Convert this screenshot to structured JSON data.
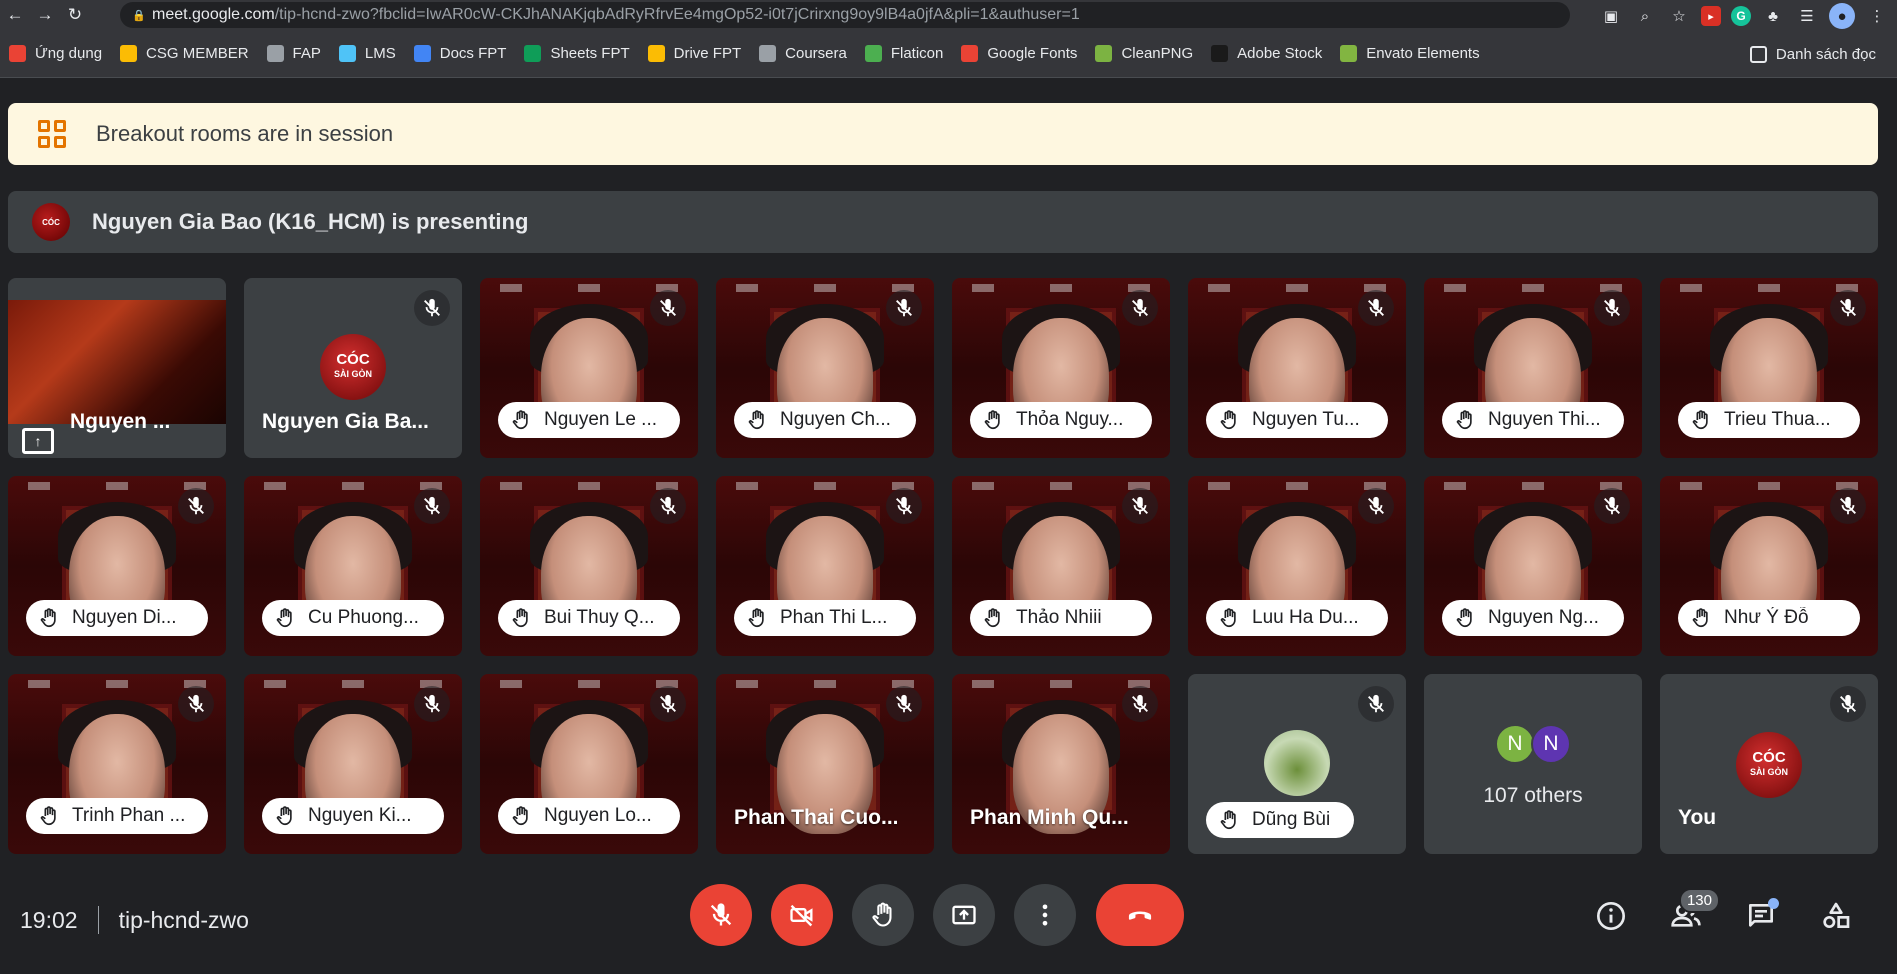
{
  "browser": {
    "url_host": "meet.google.com",
    "url_rest": "/tip-hcnd-zwo?fbclid=IwAR0cW-CKJhANAKjqbAdRyRfrvEe4mgOp52-i0t7jCrirxng9oy9lB4a0jfA&pli=1&authuser=1",
    "bookmarks": [
      {
        "label": "Ứng dụng",
        "icon": "apps-grid-icon",
        "color": "#ea4335"
      },
      {
        "label": "CSG MEMBER",
        "icon": "crown-icon",
        "color": "#fbbc04"
      },
      {
        "label": "FAP",
        "icon": "globe-icon",
        "color": "#9aa0a6"
      },
      {
        "label": "LMS",
        "icon": "lms-icon",
        "color": "#4fc3f7"
      },
      {
        "label": "Docs FPT",
        "icon": "docs-icon",
        "color": "#4285f4"
      },
      {
        "label": "Sheets FPT",
        "icon": "sheets-icon",
        "color": "#0f9d58"
      },
      {
        "label": "Drive FPT",
        "icon": "drive-icon",
        "color": "#fbbc04"
      },
      {
        "label": "Coursera",
        "icon": "globe-icon",
        "color": "#9aa0a6"
      },
      {
        "label": "Flaticon",
        "icon": "flaticon-icon",
        "color": "#4caf50"
      },
      {
        "label": "Google Fonts",
        "icon": "google-fonts-icon",
        "color": "#ea4335"
      },
      {
        "label": "CleanPNG",
        "icon": "cleanpng-icon",
        "color": "#7cb342"
      },
      {
        "label": "Adobe Stock",
        "icon": "adobe-stock-icon",
        "color": "#1a1a1a"
      },
      {
        "label": "Envato Elements",
        "icon": "envato-icon",
        "color": "#82b541"
      }
    ],
    "reading_list": "Danh sách đọc"
  },
  "banner": {
    "text": "Breakout rooms are in session"
  },
  "presenting": {
    "text": "Nguyen Gia Bao (K16_HCM) is presenting"
  },
  "tiles": {
    "presentation": {
      "name": "Nguyen ..."
    },
    "presenter_avatar": {
      "name": "Nguyen Gia Ba...",
      "avatar_top": "CÓC",
      "avatar_bottom": "SÀI GÒN"
    },
    "row1": [
      "Nguyen Le ...",
      "Nguyen Ch...",
      "Thỏa Nguy...",
      "Nguyen Tu...",
      "Nguyen Thi...",
      "Trieu Thua..."
    ],
    "row2": [
      "Nguyen Di...",
      "Cu Phuong...",
      "Bui Thuy Q...",
      "Phan Thi L...",
      "Thảo Nhiii",
      "Luu Ha Du...",
      "Nguyen Ng...",
      "Như Ý Đỗ"
    ],
    "row3_pills": [
      "Trinh Phan ...",
      "Nguyen Ki...",
      "Nguyen Lo..."
    ],
    "row3_plain": [
      "Phan Thai Cuo...",
      "Phan Minh Qu..."
    ],
    "dung": {
      "name": "Dũng Bùi"
    },
    "others": {
      "initial_a": "N",
      "initial_b": "N",
      "label": "107 others",
      "color_a": "#7cb342",
      "color_b": "#5e35b1"
    },
    "you": {
      "name": "You",
      "avatar_top": "CÓC",
      "avatar_bottom": "SÀI GÒN"
    }
  },
  "bottom": {
    "time": "19:02",
    "meeting_code": "tip-hcnd-zwo",
    "participants_count": "130"
  }
}
